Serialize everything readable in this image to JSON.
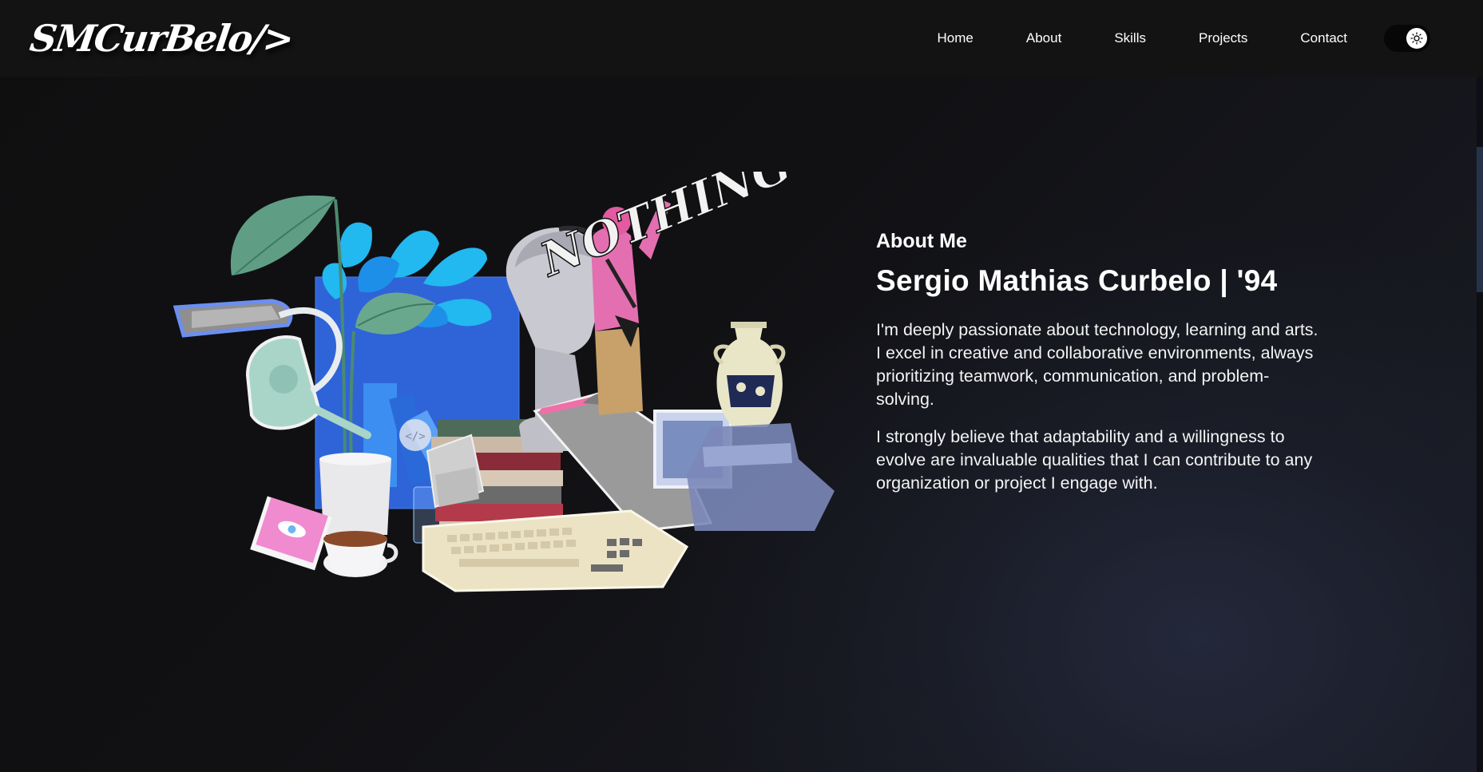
{
  "header": {
    "logo_text": "SMCurBelo/>",
    "nav": [
      "Home",
      "About",
      "Skills",
      "Projects",
      "Contact"
    ],
    "theme_toggle_icon": "sun-icon"
  },
  "illustration": {
    "code_badge": "</>",
    "graffiti_text": "NOTHING"
  },
  "about": {
    "heading": "About Me",
    "name": "Sergio Mathias Curbelo | '94",
    "paragraph1_line1": "I'm deeply passionate about technology, learning and arts.",
    "paragraph1_line2": "I excel in creative and collaborative environments, always prioritizing teamwork, communication, and problem-solving.",
    "paragraph2": "I strongly believe that adaptability and a willingness to evolve are invaluable qualities that I can contribute to any organization or project I engage with."
  },
  "colors": {
    "background": "#0f0f10",
    "navbar": "#131313",
    "text": "#ffffff",
    "accent_blue": "#3d7be3",
    "accent_pink": "#f08bd0"
  }
}
